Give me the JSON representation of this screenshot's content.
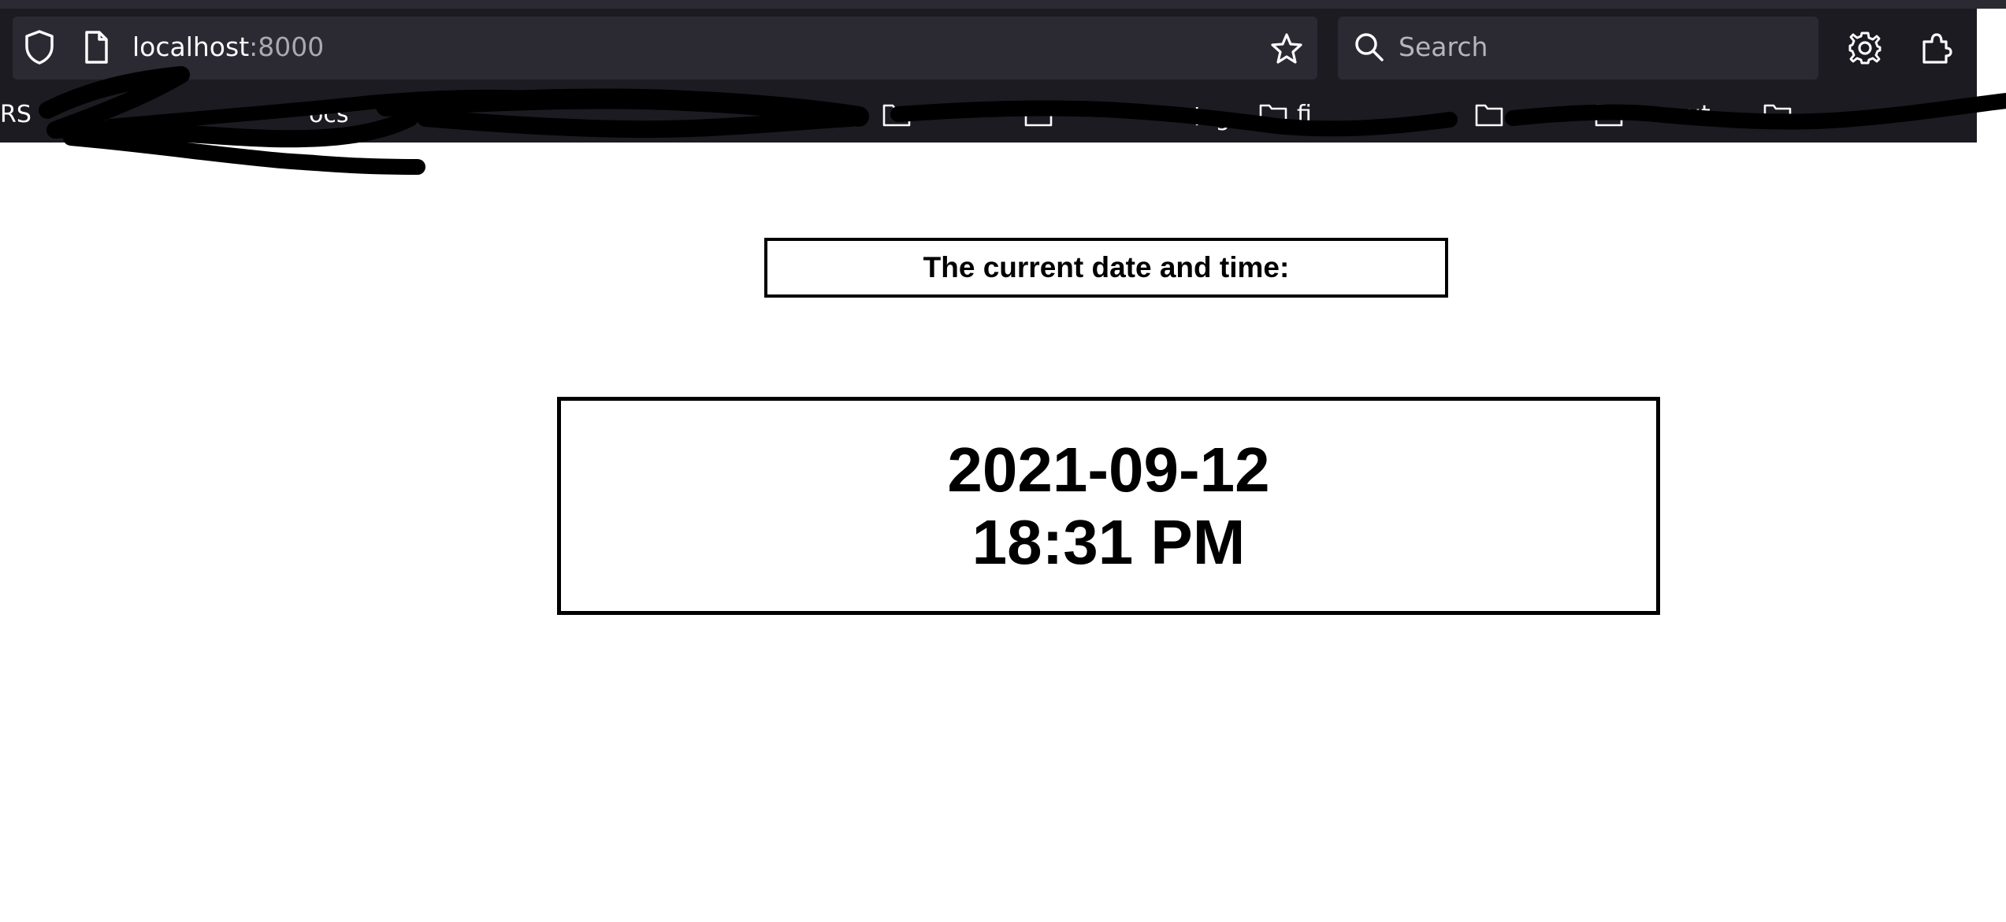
{
  "browser": {
    "url_host": "localhost",
    "url_port": ":8000",
    "search_placeholder": "Search",
    "icons": {
      "tracking_protection": "shield-icon",
      "page_info": "page-icon",
      "bookmark": "star-icon",
      "search": "search-icon",
      "settings": "gear-icon",
      "extensions": "extensions-icon",
      "bookmark_folder": "folder-icon"
    },
    "bookmarks_visible_fragments": [
      "RS",
      "ocs",
      "ing",
      "fi",
      "ut"
    ]
  },
  "page": {
    "label": "The current date and time:",
    "date": "2021-09-12",
    "time": "18:31 PM"
  }
}
